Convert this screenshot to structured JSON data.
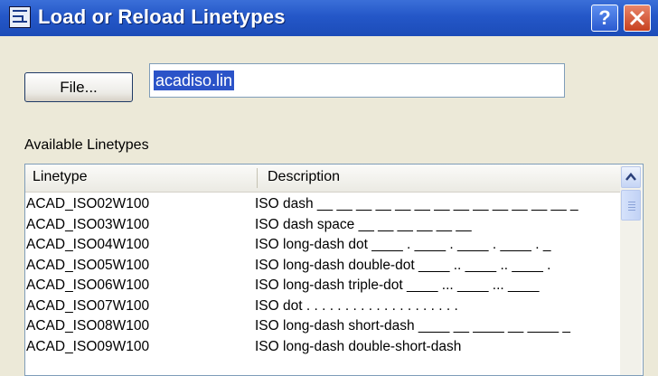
{
  "window": {
    "title": "Load or Reload Linetypes",
    "help_label": "?"
  },
  "file": {
    "button_label": "File...",
    "value": "acadiso.lin"
  },
  "available_label": "Available Linetypes",
  "columns": {
    "linetype": "Linetype",
    "description": "Description"
  },
  "rows": [
    {
      "linetype": "ACAD_ISO02W100",
      "description": "ISO dash __ __ __ __ __ __ __ __ __ __ __ __ __ _"
    },
    {
      "linetype": "ACAD_ISO03W100",
      "description": "ISO dash space __    __    __    __    __    __"
    },
    {
      "linetype": "ACAD_ISO04W100",
      "description": "ISO long-dash dot ____ . ____ . ____ . ____ . _"
    },
    {
      "linetype": "ACAD_ISO05W100",
      "description": "ISO long-dash double-dot ____ .. ____ .. ____ ."
    },
    {
      "linetype": "ACAD_ISO06W100",
      "description": "ISO long-dash triple-dot ____ ... ____ ... ____"
    },
    {
      "linetype": "ACAD_ISO07W100",
      "description": "ISO dot . . . . . . . . . . . . . . . . . . . ."
    },
    {
      "linetype": "ACAD_ISO08W100",
      "description": "ISO long-dash short-dash ____ __ ____ __ ____ _"
    },
    {
      "linetype": "ACAD_ISO09W100",
      "description": "ISO long-dash double-short-dash"
    }
  ]
}
